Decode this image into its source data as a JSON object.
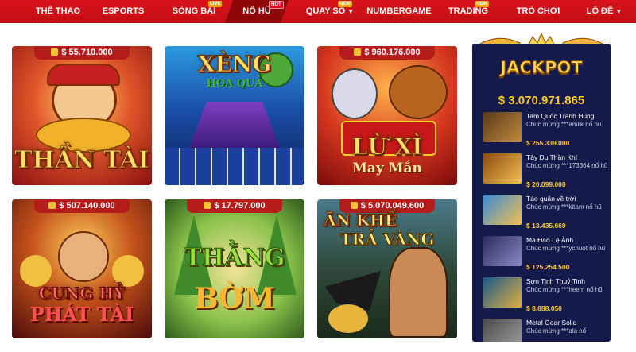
{
  "nav": {
    "items": [
      {
        "label": "THỂ THAO"
      },
      {
        "label": "ESPORTS"
      },
      {
        "label": "SÒNG BÀI",
        "badge": "LIVE"
      },
      {
        "label": "NỔ HŨ",
        "badge": "HOT"
      },
      {
        "label": "QUAY SỐ",
        "badge": "NEW",
        "dropdown": true
      },
      {
        "label": "NUMBERGAME"
      },
      {
        "label": "TRADING",
        "badge": "NEW"
      },
      {
        "label": "TRÒ CHƠI"
      },
      {
        "label": "LÔ ĐỀ",
        "dropdown": true
      }
    ],
    "active": "NỔ HŨ",
    "dropdown_icon": "chevron-down-icon"
  },
  "games": [
    {
      "prize": "$ 55.710.000",
      "title": "THẦN TÀI"
    },
    {
      "prize": "",
      "title": "XÈNG",
      "subtitle": "HOA QUẢ"
    },
    {
      "prize": "$ 960.176.000",
      "title": "LỪ XÌ",
      "subtitle": "May Mắn"
    },
    {
      "prize": "$ 507.140.000",
      "title": "CUNG HỶ",
      "subtitle": "PHÁT TÀI"
    },
    {
      "prize": "$ 17.797.000",
      "title": "THẰNG",
      "subtitle": "BỜM"
    },
    {
      "prize": "$ 5.070.049.600",
      "title": "ĂN KHẾ",
      "subtitle": "TRẢ VÀNG"
    }
  ],
  "jackpot": {
    "heading": "JACKPOT",
    "amount": "$ 3.070.971.865",
    "winners": [
      {
        "game": "Tam Quốc Tranh Hùng",
        "message": "Chúc mừng ***amilk nổ hũ",
        "amount": "$ 255.339.000"
      },
      {
        "game": "Tây Du Thần Khí",
        "message": "Chúc mừng ***173364 nổ hũ",
        "amount": "$ 20.099.000"
      },
      {
        "game": "Táo quân về trời",
        "message": "Chúc mừng ***kitam nổ hũ",
        "amount": "$ 13.435.669"
      },
      {
        "game": "Ma Đao Lệ Ảnh",
        "message": "Chúc mừng ***ychuot nổ hũ",
        "amount": "$ 125.254.500"
      },
      {
        "game": "Sơn Tinh Thuỷ Tinh",
        "message": "Chúc mừng ***heem nổ hũ",
        "amount": "$ 8.888.050"
      },
      {
        "game": "Metal Gear Solid",
        "message": "Chúc mừng ***ala nổ",
        "amount": ""
      }
    ]
  },
  "colors": {
    "nav_bg": "#d8141a",
    "nav_active": "#8e0709",
    "prize_tab": "#b51d1d",
    "jackpot_bg": "#141a4a",
    "gold": "#ffc928"
  }
}
